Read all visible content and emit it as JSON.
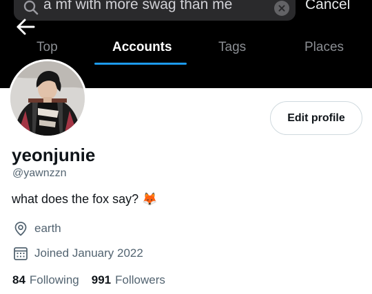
{
  "search": {
    "query": "a mf with more swag than me",
    "cancel_label": "Cancel"
  },
  "tabs": [
    {
      "label": "Top"
    },
    {
      "label": "Accounts"
    },
    {
      "label": "Tags"
    },
    {
      "label": "Places"
    }
  ],
  "active_tab": "Accounts",
  "profile": {
    "edit_button": "Edit profile",
    "display_name": "yeonjunie",
    "handle": "@yawnzzn",
    "bio": "what does the fox say? 🦊",
    "location": "earth",
    "joined": "Joined January 2022",
    "following_count": "84",
    "following_label": "Following",
    "followers_count": "991",
    "followers_label": "Followers"
  },
  "icons": {
    "back": "arrow-left-icon",
    "search": "search-icon",
    "clear": "clear-icon",
    "location": "location-pin-icon",
    "calendar": "calendar-icon"
  },
  "colors": {
    "header_bg": "#000000",
    "accent": "#1d9bf0",
    "secondary_text": "#536471"
  }
}
